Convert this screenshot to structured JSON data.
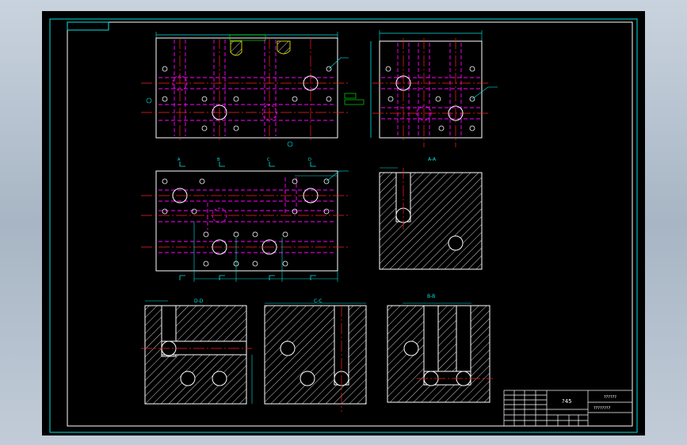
{
  "colors": {
    "background": "#000000",
    "frame": "#00e5e5",
    "outline": "#ffffff",
    "hidden_line": "#ff00ff",
    "center_line": "#ff2020",
    "hatch": "#ffffff",
    "dimension": "#00e5e5",
    "annotation": "#00ff00",
    "title_block": "#ffffff"
  },
  "section_labels": {
    "a_a": "A-A",
    "b_b": "B-B",
    "c_c": "C-C",
    "d_d": "D-D"
  },
  "section_markers": {
    "a": "A",
    "b": "B",
    "c": "C",
    "d": "D"
  },
  "title_block": {
    "material": "?45",
    "drawing_title": "??????",
    "drawing_number": "????????"
  }
}
